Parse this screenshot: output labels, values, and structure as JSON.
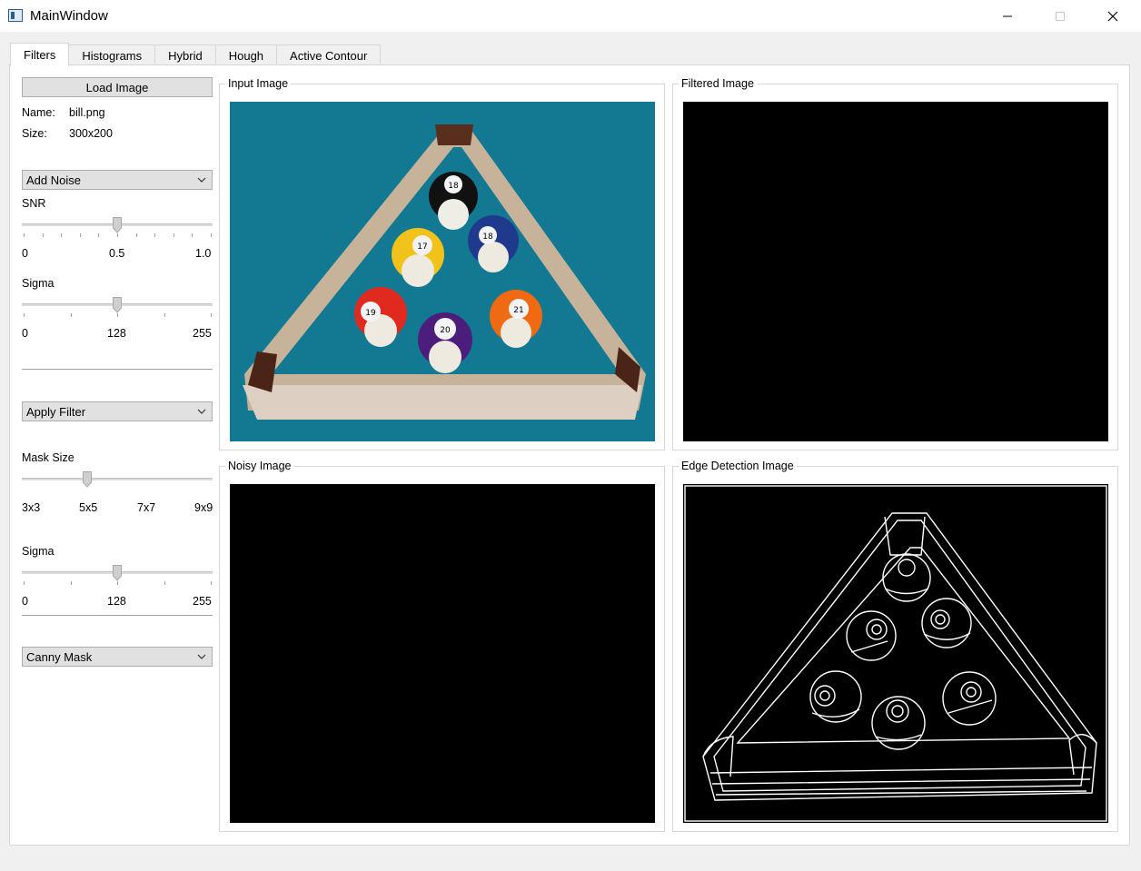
{
  "window": {
    "title": "MainWindow",
    "minimize_icon": "minimize-icon",
    "maximize_icon": "maximize-icon",
    "close_icon": "close-icon"
  },
  "tabs": [
    {
      "label": "Filters",
      "active": true
    },
    {
      "label": "Histograms",
      "active": false
    },
    {
      "label": "Hybrid",
      "active": false
    },
    {
      "label": "Hough",
      "active": false
    },
    {
      "label": "Active Contour",
      "active": false
    }
  ],
  "left_panel": {
    "load_button": "Load Image",
    "name_label": "Name:",
    "name_value": "bill.png",
    "size_label": "Size:",
    "size_value": "300x200",
    "noise_combo": "Add Noise",
    "snr": {
      "label": "SNR",
      "min_label": "0",
      "mid_label": "0.5",
      "max_label": "1.0",
      "value": 0.5
    },
    "noise_sigma": {
      "label": "Sigma",
      "min_label": "0",
      "mid_label": "128",
      "max_label": "255",
      "value": 128
    },
    "filter_combo": "Apply Filter",
    "mask_size": {
      "label": "Mask Size",
      "labels": [
        "3x3",
        "5x5",
        "7x7",
        "9x9"
      ],
      "value": "5x5"
    },
    "filter_sigma": {
      "label": "Sigma",
      "min_label": "0",
      "mid_label": "128",
      "max_label": "255",
      "value": 128
    },
    "edge_combo": "Canny Mask"
  },
  "groups": {
    "input": "Input Image",
    "filtered": "Filtered Image",
    "noisy": "Noisy Image",
    "edge": "Edge Detection Image"
  },
  "billiard_balls": [
    "18",
    "17",
    "18",
    "19",
    "20",
    "21"
  ],
  "colors": {
    "felt": "#137891",
    "rack_wood": "#c7b39a",
    "view_bg": "#000000",
    "edge_line": "#ffffff"
  }
}
